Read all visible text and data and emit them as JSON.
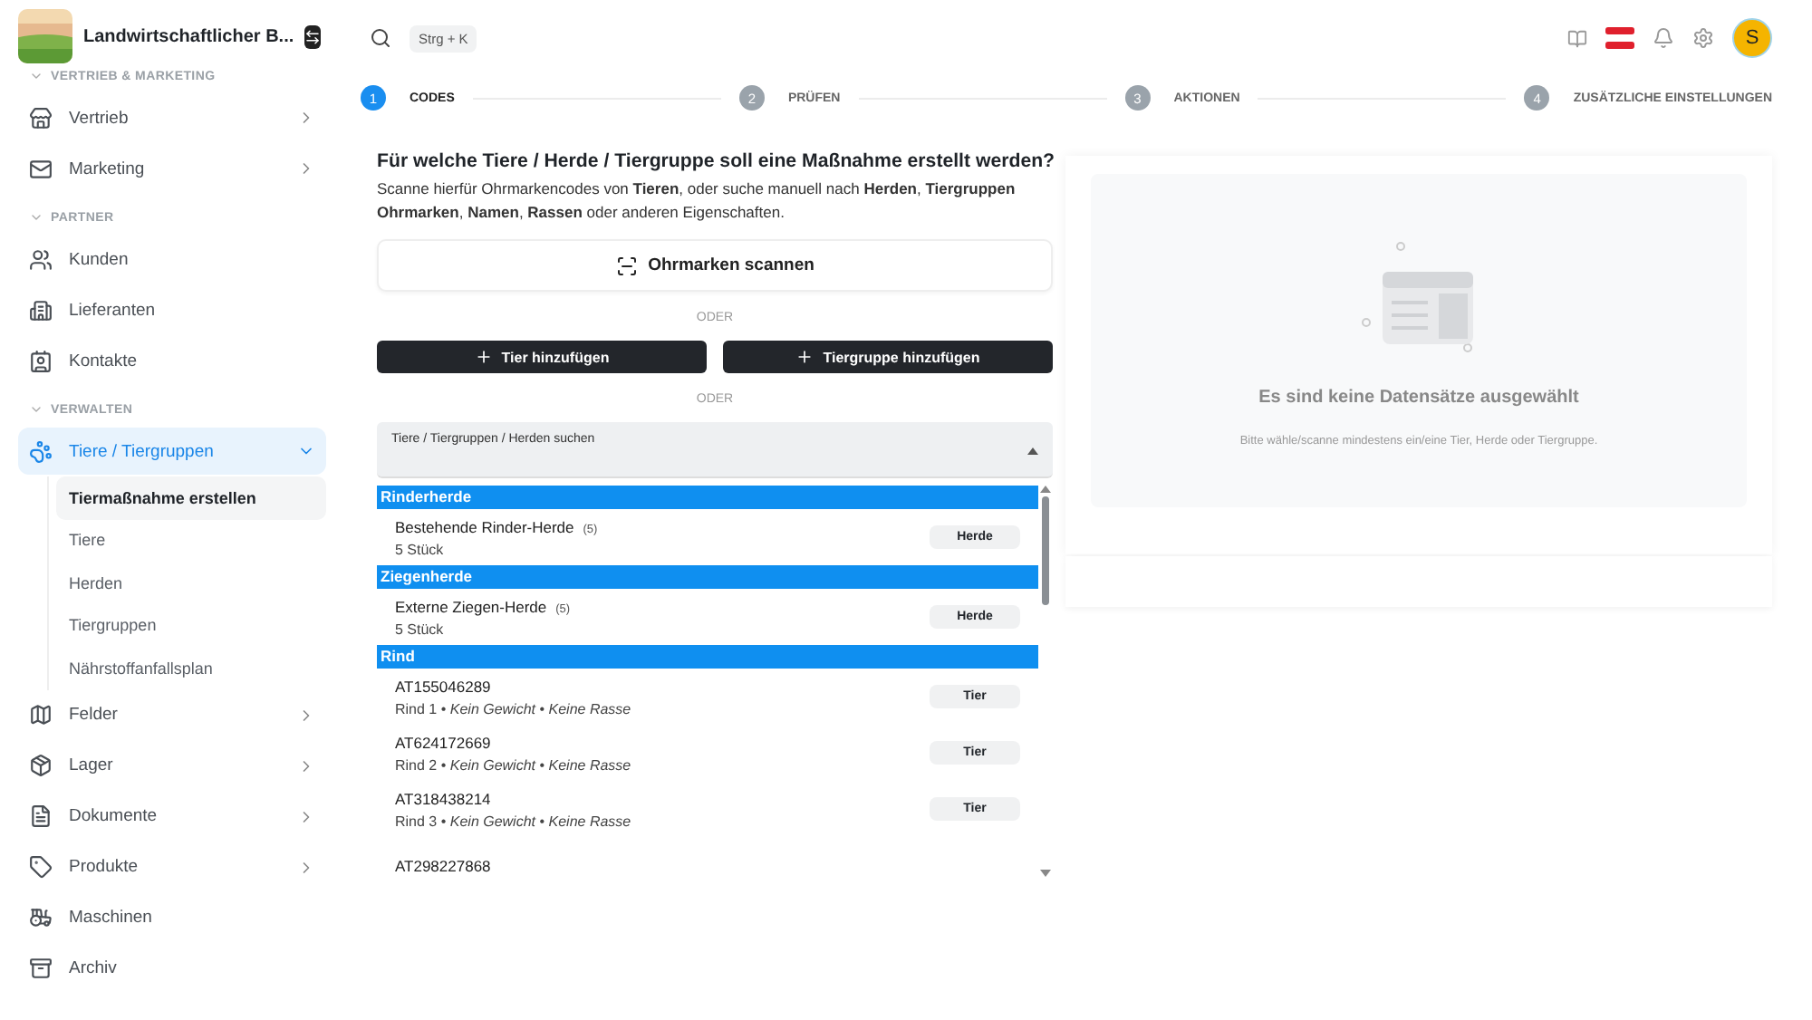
{
  "brand": {
    "name": "Landwirtschaftlicher B..."
  },
  "sidebar": {
    "sections": [
      {
        "title": "VERTRIEB & MARKETING",
        "items": [
          {
            "label": "Vertrieb",
            "has_children": true,
            "expanded": false,
            "selected": false
          },
          {
            "label": "Marketing",
            "has_children": true,
            "expanded": false,
            "selected": false
          }
        ]
      },
      {
        "title": "PARTNER",
        "items": [
          {
            "label": "Kunden",
            "has_children": false,
            "selected": false
          },
          {
            "label": "Lieferanten",
            "has_children": false,
            "selected": false
          },
          {
            "label": "Kontakte",
            "has_children": false,
            "selected": false
          }
        ]
      },
      {
        "title": "VERWALTEN",
        "items": [
          {
            "label": "Tiere / Tiergruppen",
            "has_children": true,
            "expanded": true,
            "selected": true,
            "children": [
              {
                "label": "Tiermaßnahme erstellen",
                "selected": true
              },
              {
                "label": "Tiere",
                "selected": false
              },
              {
                "label": "Herden",
                "selected": false
              },
              {
                "label": "Tiergruppen",
                "selected": false
              },
              {
                "label": "Nährstoffanfallsplan",
                "selected": false
              }
            ]
          },
          {
            "label": "Felder",
            "has_children": true,
            "expanded": false,
            "selected": false
          },
          {
            "label": "Lager",
            "has_children": true,
            "expanded": false,
            "selected": false
          },
          {
            "label": "Dokumente",
            "has_children": true,
            "expanded": false,
            "selected": false
          },
          {
            "label": "Produkte",
            "has_children": true,
            "expanded": false,
            "selected": false
          },
          {
            "label": "Maschinen",
            "has_children": false,
            "selected": false
          },
          {
            "label": "Archiv",
            "has_children": false,
            "selected": false
          }
        ]
      }
    ]
  },
  "header": {
    "shortcut": "Strg + K",
    "avatar": "S"
  },
  "stepper": [
    {
      "number": "1",
      "label": "CODES",
      "selected": true
    },
    {
      "number": "2",
      "label": "PRÜFEN",
      "selected": false
    },
    {
      "number": "3",
      "label": "AKTIONEN",
      "selected": false
    },
    {
      "number": "4",
      "label": "ZUSÄTZLICHE EINSTELLUNGEN",
      "selected": false
    }
  ],
  "question": {
    "title": "Für welche Tiere / Herde / Tiergruppe soll eine Maßnahme erstellt werden?",
    "description": "Scanne hierfür Ohrmarkencodes von **Tieren**, oder suche manuell nach **Herden**, **Tiergruppen** **Ohrmarken**, **Namen**, **Rassen** oder anderen Eigenschaften."
  },
  "scan_button": "Ohrmarken scannen",
  "separators": [
    "ODER",
    "ODER"
  ],
  "add_buttons": [
    "Tier hinzufügen",
    "Tiergruppe hinzufügen"
  ],
  "search": {
    "label": "Tiere / Tiergruppen / Herden suchen",
    "expanded": true
  },
  "results": [
    {
      "title": "Rinderherde",
      "items": [
        {
          "title": "Bestehende Rinder-Herde",
          "count": "(5)",
          "subtitle": "5 Stück",
          "tag": "Herde"
        }
      ]
    },
    {
      "title": "Ziegenherde",
      "items": [
        {
          "title": "Externe Ziegen-Herde",
          "count": "(5)",
          "subtitle": "5 Stück",
          "tag": "Herde"
        }
      ]
    },
    {
      "title": "Rind",
      "items": [
        {
          "title": "AT155046289",
          "subtitle": "Rind 1 • *Kein Gewicht* • *Keine Rasse*",
          "tag": "Tier"
        },
        {
          "title": "AT624172669",
          "subtitle": "Rind 2 • *Kein Gewicht* • *Keine Rasse*",
          "tag": "Tier"
        },
        {
          "title": "AT318438214",
          "subtitle": "Rind 3 • *Kein Gewicht* • *Keine Rasse*",
          "tag": "Tier"
        },
        {
          "title": "AT298227868"
        }
      ]
    }
  ],
  "empty_state": {
    "title": "Es sind keine Datensätze ausgewählt",
    "text": "Bitte wähle/scanne mindestens ein/eine Tier, Herde oder Tiergruppe."
  }
}
